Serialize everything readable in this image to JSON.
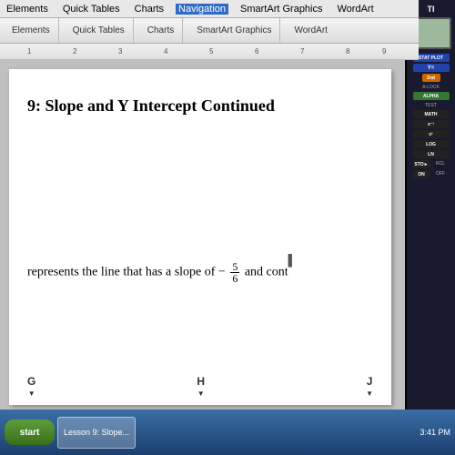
{
  "menubar": {
    "items": [
      "Elements",
      "Quick Tables",
      "Charts",
      "SmartArt Graphics",
      "WordArt"
    ],
    "nav_label": "Navigation"
  },
  "toolbar": {
    "groups": [
      {
        "label": "Elements"
      },
      {
        "label": "Quick Tables"
      },
      {
        "label": "Charts"
      },
      {
        "label": "SmartArt Graphics"
      },
      {
        "label": "WordArt"
      }
    ]
  },
  "document": {
    "title": "9: Slope and Y Intercept Continued",
    "content_prefix": "represents the line that has a slope of −",
    "content_suffix": "and cont",
    "fraction_num": "5",
    "fraction_den": "6"
  },
  "columns": {
    "labels": [
      "G",
      "H",
      "J"
    ]
  },
  "calculator": {
    "screen_value": "",
    "logo": "TI",
    "buttons": [
      {
        "label": "STAT PLOT",
        "color": "blue"
      },
      {
        "label": "Y=",
        "color": "blue"
      },
      {
        "label": "2nd",
        "color": "blue"
      },
      {
        "label": "A-LOCK",
        "color": "gray"
      },
      {
        "label": "ALPHA",
        "color": "green"
      },
      {
        "label": "TEST",
        "color": "gray"
      },
      {
        "label": "MATH",
        "color": "dark"
      },
      {
        "label": "x⁻¹",
        "color": "dark"
      },
      {
        "label": "x²",
        "color": "dark"
      },
      {
        "label": "LOG",
        "color": "dark"
      },
      {
        "label": "LN",
        "color": "dark"
      },
      {
        "label": "STO►",
        "color": "dark"
      },
      {
        "label": "RCL",
        "color": "gray"
      },
      {
        "label": "ON",
        "color": "dark"
      },
      {
        "label": "OFF",
        "color": "gray"
      }
    ]
  },
  "taskbar": {
    "start_label": "start",
    "app_label": "Lesson 9: Slope...",
    "time": "3:41 PM"
  }
}
